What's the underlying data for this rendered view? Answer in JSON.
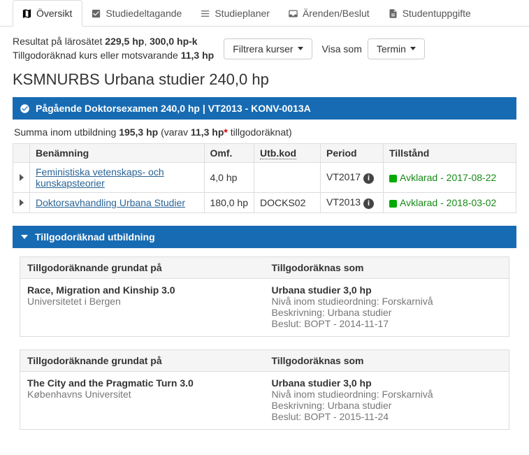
{
  "tabs": {
    "overview": "Översikt",
    "participation": "Studiedeltagande",
    "plans": "Studieplaner",
    "cases": "Ärenden/Beslut",
    "studentinfo": "Studentuppgifte"
  },
  "summary": {
    "line1_pre": "Resultat på lärosätet ",
    "line1_val1": "229,5 hp",
    "line1_sep": ", ",
    "line1_val2": "300,0 hp-k",
    "line2_pre": "Tillgodoräknad kurs eller motsvarande ",
    "line2_val": "11,3 hp"
  },
  "controls": {
    "filter": "Filtrera kurser",
    "view_label": "Visa som",
    "view_value": "Termin"
  },
  "heading": "KSMNURBS Urbana studier 240,0 hp",
  "bar1": "Pågående Doktorsexamen 240,0 hp | VT2013 - KONV-0013A",
  "subsum": {
    "pre": "Summa inom utbildning ",
    "val": "195,3 hp",
    "mid": " (varav ",
    "val2": "11,3 hp",
    "ast": "*",
    "post": " tillgodoräknat)"
  },
  "thead": {
    "name": "Benämning",
    "scope": "Omf.",
    "code": "Utb.kod",
    "period": "Period",
    "state": "Tillstånd"
  },
  "rows": [
    {
      "name": "Feministiska vetenskaps- och kunskapsteorier",
      "scope": "4,0 hp",
      "code": "",
      "period": "VT2017",
      "status_label": "Avklarad",
      "status_date": "2017-08-22"
    },
    {
      "name": "Doktorsavhandling Urbana Studier",
      "scope": "180,0 hp",
      "code": "DOCKS02",
      "period": "VT2013",
      "status_label": "Avklarad",
      "status_date": "2018-03-02"
    }
  ],
  "bar2": "Tillgodoräknad utbildning",
  "credit_head": {
    "left": "Tillgodoräknande grundat på",
    "right": "Tillgodoräknas som"
  },
  "credits": [
    {
      "left_title": "Race, Migration and Kinship 3.0",
      "left_sub": "Universitetet i Bergen",
      "right_title": "Urbana studier 3,0 hp",
      "right_l1": "Nivå inom studieordning: Forskarnivå",
      "right_l2": "Beskrivning: Urbana studier",
      "right_l3": "Beslut: BOPT - 2014-11-17"
    },
    {
      "left_title": "The City and the Pragmatic Turn 3.0",
      "left_sub": "Københavns Universitet",
      "right_title": "Urbana studier 3,0 hp",
      "right_l1": "Nivå inom studieordning: Forskarnivå",
      "right_l2": "Beskrivning: Urbana studier",
      "right_l3": "Beslut: BOPT - 2015-11-24"
    }
  ]
}
